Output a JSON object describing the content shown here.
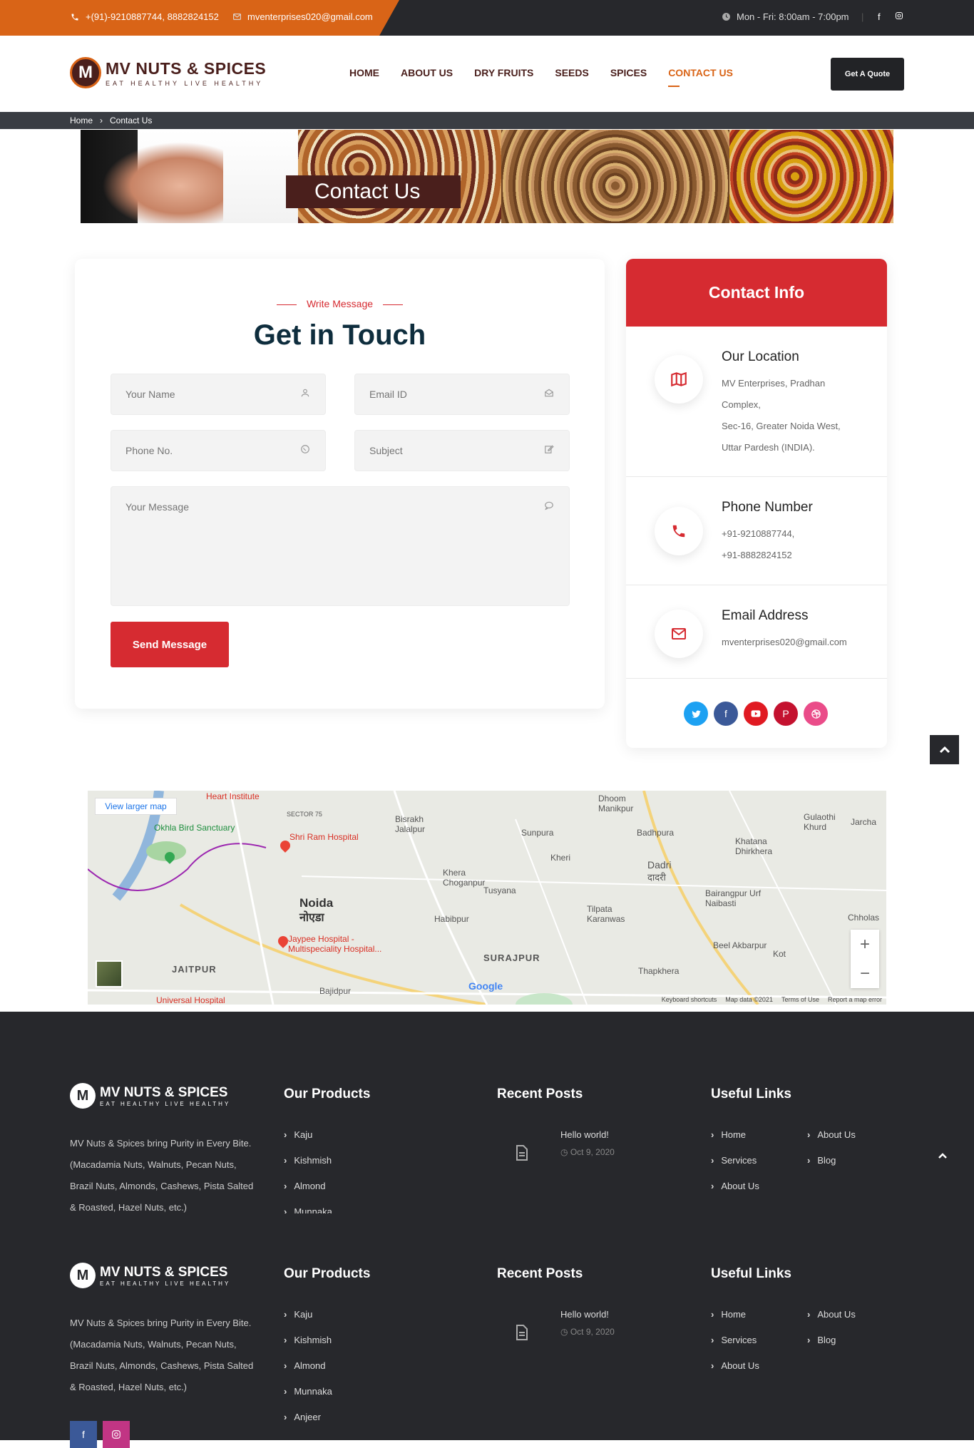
{
  "topbar": {
    "phone": "+(91)-9210887744, 8882824152",
    "email": "mventerprises020@gmail.com",
    "hours": "Mon - Fri: 8:00am - 7:00pm"
  },
  "brand": {
    "letter": "M",
    "name": "MV NUTS & SPICES",
    "tagline": "EAT HEALTHY LIVE HEALTHY"
  },
  "nav": {
    "items": [
      "HOME",
      "ABOUT US",
      "DRY FRUITS",
      "SEEDS",
      "SPICES",
      "CONTACT US"
    ],
    "active": "CONTACT US",
    "quote": "Get A Quote"
  },
  "breadcrumb": {
    "home": "Home",
    "sep": "›",
    "current": "Contact Us"
  },
  "hero": {
    "title": "Contact Us"
  },
  "form": {
    "eyebrow": "Write Message",
    "title": "Get in Touch",
    "name_ph": "Your Name",
    "email_ph": "Email ID",
    "phone_ph": "Phone No.",
    "subject_ph": "Subject",
    "message_ph": "Your Message",
    "send": "Send Message"
  },
  "contact_info": {
    "title": "Contact Info",
    "location": {
      "heading": "Our Location",
      "lines": [
        "MV Enterprises, Pradhan",
        "Complex,",
        "Sec-16, Greater Noida West,",
        "Uttar Pardesh (INDIA)."
      ]
    },
    "phone": {
      "heading": "Phone Number",
      "lines": [
        "+91-9210887744,",
        "+91-8882824152"
      ]
    },
    "email": {
      "heading": "Email Address",
      "lines": [
        "mventerprises020@gmail.com"
      ]
    },
    "social_colors": [
      "#1da1f2",
      "#3b5998",
      "#e01a22",
      "#c4122f",
      "#ea4c89"
    ]
  },
  "map": {
    "view_larger": "View larger map",
    "labels": [
      "Noida",
      "नोएडा",
      "Shri Ram Hospital",
      "Okhla Bird Sanctuary",
      "Jaypee Hospital - Multispeciality Hospital...",
      "SURAJPUR",
      "Dadri",
      "दादरी",
      "JAITPUR",
      "Bisrakh Jalalpur",
      "Khera Choganpur",
      "Tusyana",
      "Habibpur",
      "Kheri",
      "Sunpura",
      "Dhoom Manikpur",
      "Badhpura",
      "Khatana Dhirkhera",
      "Bairangpur Urf Naibasti",
      "Tilpata Karanwas",
      "Thapkhera",
      "Beel Akbarpur",
      "Kot",
      "Gulaothi Khurd",
      "Jarcha",
      "Chholas",
      "SECTOR 75",
      "Heart Institute",
      "Universal Hospital",
      "Bajidpur"
    ],
    "footer": [
      "Keyboard shortcuts",
      "Map data ©2021",
      "Terms of Use",
      "Report a map error"
    ],
    "brand": "Google"
  },
  "footer": {
    "about": "MV Nuts & Spices bring Purity in Every Bite. (Macadamia Nuts, Walnuts, Pecan Nuts, Brazil Nuts, Almonds, Cashews, Pista Salted & Roasted, Hazel Nuts, etc.)",
    "products_title": "Our Products",
    "products_a": [
      "Kaju",
      "Kishmish",
      "Almond",
      "Munnaka"
    ],
    "products_b": [
      "Kaju",
      "Kishmish",
      "Almond",
      "Munnaka",
      "Anjeer"
    ],
    "posts_title": "Recent Posts",
    "post_title": "Hello world!",
    "post_date": "Oct 9, 2020",
    "links_title": "Useful Links",
    "links_left": [
      "Home",
      "Services",
      "About Us"
    ],
    "links_right": [
      "About Us",
      "Blog"
    ]
  }
}
